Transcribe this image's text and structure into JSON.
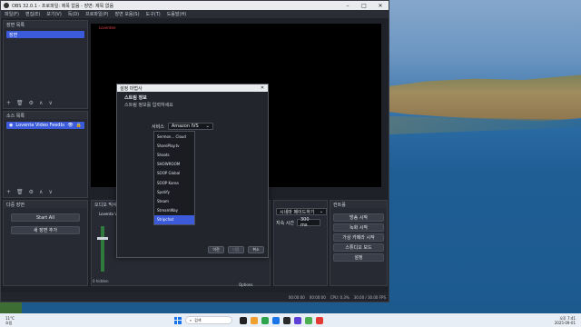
{
  "window": {
    "title": "OBS 32.0.1 - 프로파일: 제목 없음 - 장면: 제목 없음",
    "menu": [
      "파일(F)",
      "편집(E)",
      "보기(V)",
      "독(D)",
      "프로파일(P)",
      "장면 모음(S)",
      "도구(T)",
      "도움말(H)"
    ]
  },
  "scenes": {
    "title": "장면 목록",
    "items": [
      "장면"
    ]
  },
  "sources": {
    "title": "소스 목록",
    "items": [
      "Loventa Video Feedback"
    ]
  },
  "preview": {
    "watermark": "Loventee"
  },
  "transition_dock": {
    "title": "다중 장면",
    "start_all": "Start All",
    "add_scene": "새 장면 추가"
  },
  "mixer": {
    "title": "오디오 믹서",
    "track_label": "Loventa Video Fee...",
    "status": "0 hidden"
  },
  "controls": {
    "title": "컨트롤",
    "transition_label": "시네마 페이드하기",
    "duration_label": "지속 시간",
    "duration_value": "300 ms",
    "buttons": [
      "방송 시작",
      "녹화 시작",
      "가상 카메라 시작",
      "스튜디오 모드",
      "설정"
    ]
  },
  "options_label": "Options",
  "statusbar": {
    "cpu": "CPU: 0.3%",
    "fps": "30.00 / 30.00 FPS",
    "time1": "00:00:00",
    "time2": "00:00:00"
  },
  "dialog": {
    "window_title": "설정 마법사",
    "heading": "스트림 정보",
    "subheading": "스트림 정보를 입력하세요",
    "service_label": "서비스",
    "service_value": "Amazon IVS",
    "options": [
      "Sermon... Cloud",
      "SharePlay.tv",
      "Shoots",
      "SHOWROOM",
      "SOOP Global",
      "SOOP Korea",
      "Spotify",
      "Steam",
      "StreamWay",
      "Stripchat"
    ],
    "selected_index": 9,
    "buttons": {
      "back": "이전",
      "next": "다음",
      "cancel": "취소"
    }
  },
  "taskbar": {
    "weather_temp": "11°C",
    "weather_desc": "흐림",
    "search_placeholder": "검색",
    "time": "오후 7:41",
    "date": "2025-09-01"
  },
  "colors": {
    "accent": "#3b5bdb",
    "obs_bg": "#1f2128"
  }
}
